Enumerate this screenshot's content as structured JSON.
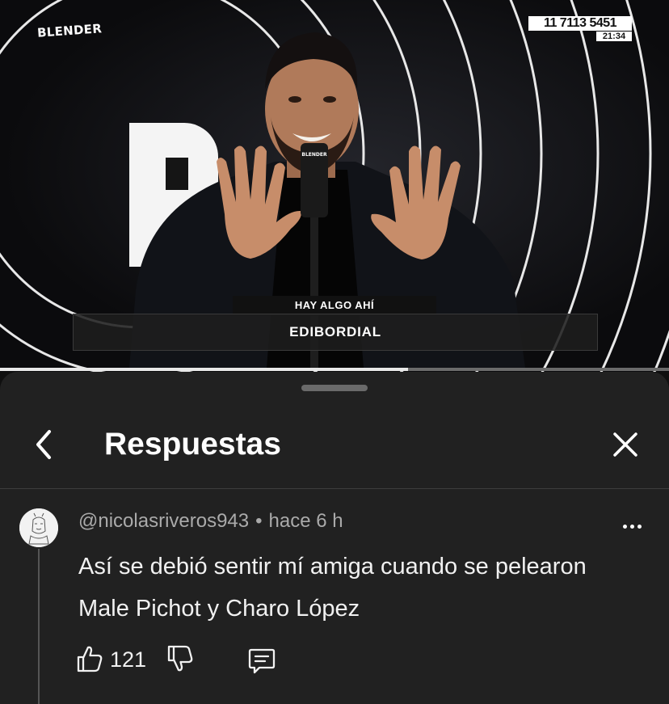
{
  "video": {
    "channel_logo": "BLENDER",
    "phone_number": "11 7113 5451",
    "time": "21:34",
    "mic_label": "BLENDER",
    "lower_third_top": "HAY ALGO AHÍ",
    "lower_third_main": "EDIBORDIAL",
    "progress_fraction": 0.61
  },
  "sheet": {
    "title": "Respuestas",
    "back_icon": "chevron-left-icon",
    "close_icon": "close-icon"
  },
  "comment": {
    "author": "@nicolasriveros943",
    "separator": "•",
    "time_ago": "hace 6 h",
    "text": "Así se debió sentir mí amiga cuando se pelearon Male Pichot y Charo López",
    "like_count": "121",
    "icons": [
      "thumbs-up-icon",
      "thumbs-down-icon",
      "reply-icon",
      "more-vertical-icon"
    ]
  },
  "colors": {
    "background": "#0f0f0f",
    "sheet": "#212121",
    "text_primary": "#f1f1f1",
    "text_secondary": "#aaaaaa"
  }
}
